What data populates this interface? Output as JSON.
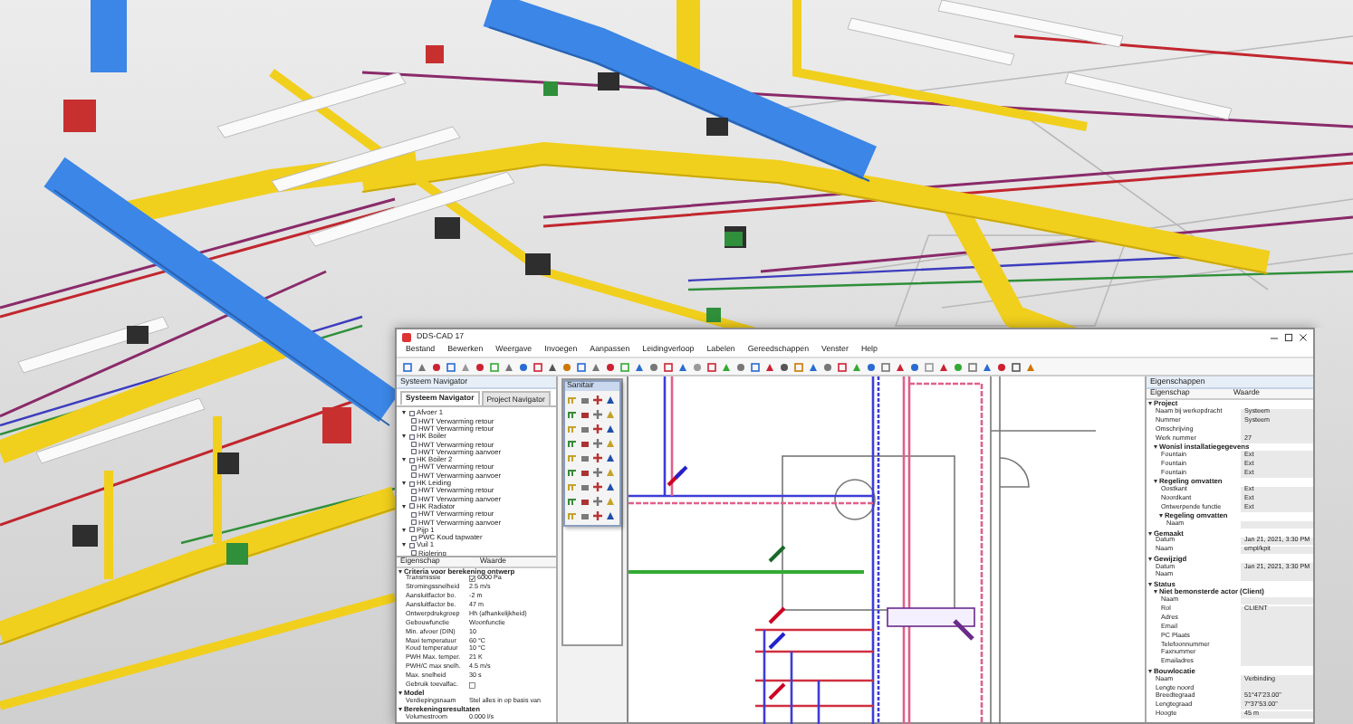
{
  "window": {
    "title": "DDS-CAD 17"
  },
  "menu": [
    "Bestand",
    "Bewerken",
    "Weergave",
    "Invoegen",
    "Aanpassen",
    "Leidingverloop",
    "Labelen",
    "Gereedschappen",
    "Venster",
    "Help"
  ],
  "navigator": {
    "title": "Systeem Navigator",
    "tabs": [
      {
        "label": "Systeem Navigator",
        "selected": true
      },
      {
        "label": "Project Navigator",
        "selected": false
      }
    ],
    "tree": [
      {
        "label": "Afvoer 1",
        "expanded": true,
        "children": [
          {
            "label": "HWT Verwarming retour"
          },
          {
            "label": "HWT Verwarming retour"
          }
        ]
      },
      {
        "label": "HK Boiler",
        "expanded": true,
        "children": [
          {
            "label": "HWT Verwarming retour"
          },
          {
            "label": "HWT Verwarming aanvoer"
          }
        ]
      },
      {
        "label": "HK Boiler 2",
        "expanded": true,
        "children": [
          {
            "label": "HWT Verwarming retour"
          },
          {
            "label": "HWT Verwarming aanvoer"
          }
        ]
      },
      {
        "label": "HK Leiding",
        "expanded": true,
        "children": [
          {
            "label": "HWT Verwarming retour"
          },
          {
            "label": "HWT Verwarming aanvoer"
          }
        ]
      },
      {
        "label": "HK Radiator",
        "expanded": true,
        "children": [
          {
            "label": "HWT Verwarming retour"
          },
          {
            "label": "HWT Verwarming aanvoer"
          }
        ]
      },
      {
        "label": "Pijp 1",
        "expanded": true,
        "children": [
          {
            "label": "PWC Koud tapwater"
          }
        ]
      },
      {
        "label": "Vuil 1",
        "expanded": true,
        "children": [
          {
            "label": "Riolering"
          }
        ]
      }
    ]
  },
  "system_properties": {
    "columns": [
      "Eigenschap",
      "Waarde"
    ],
    "sections": [
      {
        "title": "Criteria voor berekening ontwerp",
        "expanded": true,
        "rows": [
          {
            "kind": "checkbox",
            "name": "Transmissie",
            "value": "6000 Pa",
            "checked": true
          },
          {
            "name": "Stromingssnelheid",
            "value": "2.5 m/s"
          },
          {
            "name": "Aansluitfactor bo.",
            "value": "-2 m"
          },
          {
            "name": "Aansluitfactor be.",
            "value": "47 m"
          },
          {
            "name": "Ontwerpdrukgroep",
            "value": "Hh (afhankelijkheid)"
          },
          {
            "name": "Gebouwfunctie",
            "value": "Woonfunctie"
          },
          {
            "name": "Min. afvoer (DIN)",
            "value": "10"
          },
          {
            "name": "Maxi temperatuur",
            "value": "60 °C"
          },
          {
            "name": "Koud temperatuur",
            "value": "10 °C"
          },
          {
            "name": "PWH Max. temper.",
            "value": "21 K"
          },
          {
            "name": "PWH/C max snelh.",
            "value": "4.5 m/s"
          },
          {
            "name": "Max. snelheid",
            "value": "30 s"
          },
          {
            "kind": "checkbox",
            "name": "Gebruik toevalfac.",
            "value": "",
            "checked": false
          }
        ]
      },
      {
        "title": "Model",
        "expanded": true,
        "rows": [
          {
            "name": "Verdiepingsnaam",
            "value": "Stel alles in op basis van"
          }
        ]
      },
      {
        "title": "Berekeningsresultaten",
        "expanded": true,
        "rows": [
          {
            "name": "Volumestroom",
            "value": "0.000 l/s"
          }
        ]
      }
    ]
  },
  "symbol_palette": {
    "title": "Sanitair"
  },
  "properties_panel": {
    "title": "Eigenschappen",
    "columns": [
      "Eigenschap",
      "Waarde"
    ],
    "sections": [
      {
        "title": "Project",
        "expanded": true,
        "rows": [
          {
            "name": "Naam bij werkopdracht",
            "value": "Systeem"
          },
          {
            "name": "Nummer",
            "value": "Systeem"
          },
          {
            "name": "Omschrijving",
            "value": ""
          },
          {
            "name": "Werk nummer",
            "value": "27"
          }
        ],
        "sections": [
          {
            "title": "Wonisl installatiegegevens",
            "expanded": true,
            "rows": [
              {
                "name": "Fountain",
                "value": "Ext"
              },
              {
                "name": "Fountain",
                "value": "Ext"
              },
              {
                "name": "Fountain",
                "value": "Ext"
              }
            ]
          },
          {
            "title": "Regeling omvatten",
            "expanded": true,
            "rows": [
              {
                "name": "Oostkant",
                "value": "Ext"
              },
              {
                "name": "Noordkant",
                "value": "Ext"
              },
              {
                "name": "Ontwerpende functie",
                "value": "Ext"
              }
            ],
            "sections": [
              {
                "title": "Regeling omvatten",
                "expanded": true,
                "rows": [
                  {
                    "name": "Naam",
                    "value": ""
                  }
                ]
              }
            ]
          }
        ]
      },
      {
        "title": "Gemaakt",
        "expanded": true,
        "rows": [
          {
            "name": "Datum",
            "value": "Jan 21, 2021, 3:30 PM"
          },
          {
            "name": "Naam",
            "value": "empl/kpit"
          }
        ]
      },
      {
        "title": "Gewijzigd",
        "expanded": true,
        "rows": [
          {
            "name": "Datum",
            "value": "Jan 21, 2021, 3:30 PM"
          },
          {
            "name": "Naam",
            "value": ""
          }
        ]
      },
      {
        "title": "Status",
        "expanded": true,
        "sections": [
          {
            "title": "Niet bemonsterde actor (Client)",
            "expanded": true,
            "rows": [
              {
                "name": "Naam",
                "value": ""
              },
              {
                "name": "Rol",
                "value": "CLIENT"
              },
              {
                "name": "Adres",
                "value": ""
              },
              {
                "name": "Email",
                "value": ""
              },
              {
                "name": "PC Plaats",
                "value": ""
              },
              {
                "name": "Telefoonnummer",
                "value": ""
              },
              {
                "name": "Faxnummer",
                "value": ""
              },
              {
                "name": "Emailadres",
                "value": ""
              }
            ]
          }
        ]
      },
      {
        "title": "Bouwlocatie",
        "expanded": true,
        "rows": [
          {
            "name": "Naam",
            "value": "Verbinding"
          },
          {
            "name": "Lengte noord",
            "value": ""
          },
          {
            "name": "Breedtegraad",
            "value": "51°47'23.00\""
          },
          {
            "name": "Lengtegraad",
            "value": "7°37'53.00\""
          },
          {
            "name": "Hoogte",
            "value": "45 m"
          }
        ]
      }
    ]
  }
}
